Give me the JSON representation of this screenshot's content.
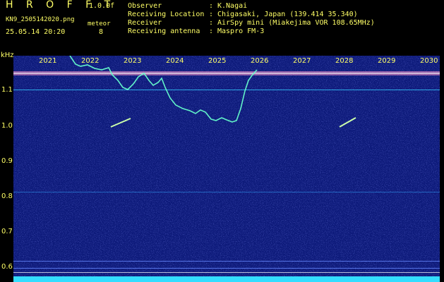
{
  "header": {
    "title": "H R O F F T",
    "version": "1.0.0f",
    "filename": "KN9_2505142020.png",
    "meteor_label": "meteor",
    "timestamp": "25.05.14 20:20",
    "meteor_count": "8"
  },
  "info": [
    {
      "key": "Observer",
      "value": "K.Nagai"
    },
    {
      "key": "Receiving Location",
      "value": "Chigasaki, Japan (139.414 35.340)"
    },
    {
      "key": "Receiver",
      "value": "AirSpy mini (Miakejima VOR 108.65MHz)"
    },
    {
      "key": "Receiving antenna",
      "value": "Maspro FM-3"
    }
  ],
  "separator": ":",
  "axis": {
    "unit": "kHz",
    "y_ticks": [
      "1.1",
      "1.0",
      "0.9",
      "0.8",
      "0.7",
      "0.6"
    ],
    "x_ticks": [
      "2021",
      "2022",
      "2023",
      "2024",
      "2025",
      "2026",
      "2027",
      "2028",
      "2029",
      "2030"
    ]
  },
  "colors": {
    "background": "#0d1a7a",
    "text": "#ffff66",
    "trace": "#66ffcc",
    "carrier": "#ff99cc",
    "noise_floor": "#33ddff"
  }
}
